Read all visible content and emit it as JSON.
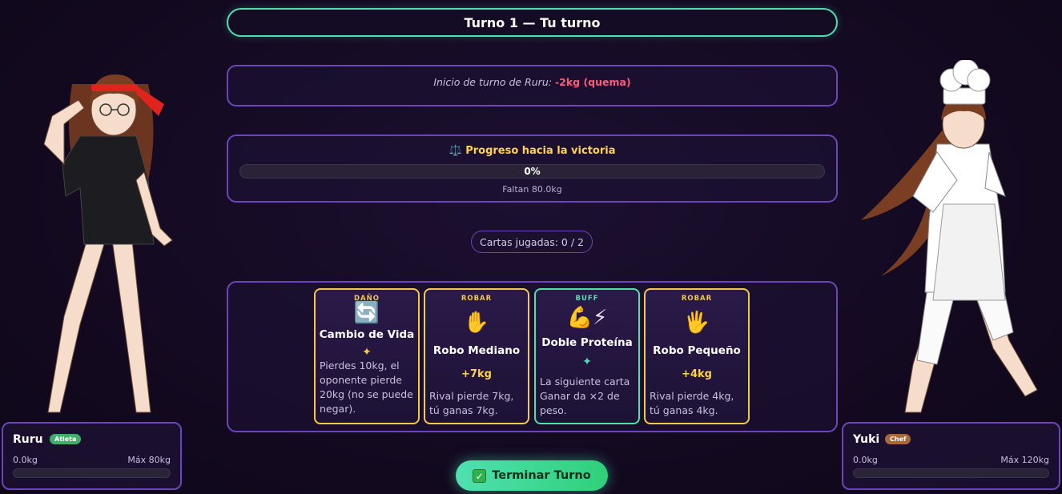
{
  "turn": {
    "banner": "Turno 1 — Tu turno"
  },
  "log": {
    "prefix": "Inicio de turno de Ruru:",
    "effect": "-2kg (quema)"
  },
  "progress": {
    "icon": "balance-scale-icon",
    "title": "⚖️ Progreso hacia la victoria",
    "percent_label": "0%",
    "percent_value": 0,
    "remaining": "Faltan 80.0kg"
  },
  "cards_played": "Cartas jugadas: 0 / 2",
  "hand": [
    {
      "type": "DAÑO",
      "icon": "swap-arrows-icon",
      "emoji": "🔄",
      "name": "Cambio de Vida",
      "spark": "✦",
      "amount": "",
      "description": "Pierdes 10kg, el oponente pierde 20kg (no se puede negar).",
      "accent": "#f2c94c"
    },
    {
      "type": "ROBAR",
      "icon": "raised-hand-icon",
      "emoji": "✋",
      "name": "Robo Mediano",
      "spark": "",
      "amount": "+7kg",
      "description": "Rival pierde 7kg, tú ganas 7kg.",
      "accent": "#f2c94c"
    },
    {
      "type": "BUFF",
      "icon": "flex-bolt-icon",
      "emoji": "💪⚡",
      "name": "Doble Proteína",
      "spark": "✦",
      "amount": "",
      "description": "La siguiente carta Ganar da ×2 de peso.",
      "accent": "#4fe0b0"
    },
    {
      "type": "ROBAR",
      "icon": "open-hand-icon",
      "emoji": "🖐",
      "name": "Robo Pequeño",
      "spark": "",
      "amount": "+4kg",
      "description": "Rival pierde 4kg, tú ganas 4kg.",
      "accent": "#f2c94c"
    }
  ],
  "end_turn": {
    "check": "✓",
    "label": "Terminar Turno"
  },
  "players": {
    "left": {
      "name": "Ruru",
      "badge": "Atleta",
      "badge_color": "#3fae6a",
      "weight": "0.0kg",
      "max": "Máx 80kg",
      "fill_fraction": 0
    },
    "right": {
      "name": "Yuki",
      "badge": "Chef",
      "badge_color": "#a8683a",
      "weight": "0.0kg",
      "max": "Máx 120kg",
      "fill_fraction": 0
    }
  },
  "colors": {
    "accent_teal": "#4fe0b0",
    "accent_purple": "#6c46b8",
    "accent_gold": "#f2c94c",
    "burn_red": "#ff5c7a"
  }
}
